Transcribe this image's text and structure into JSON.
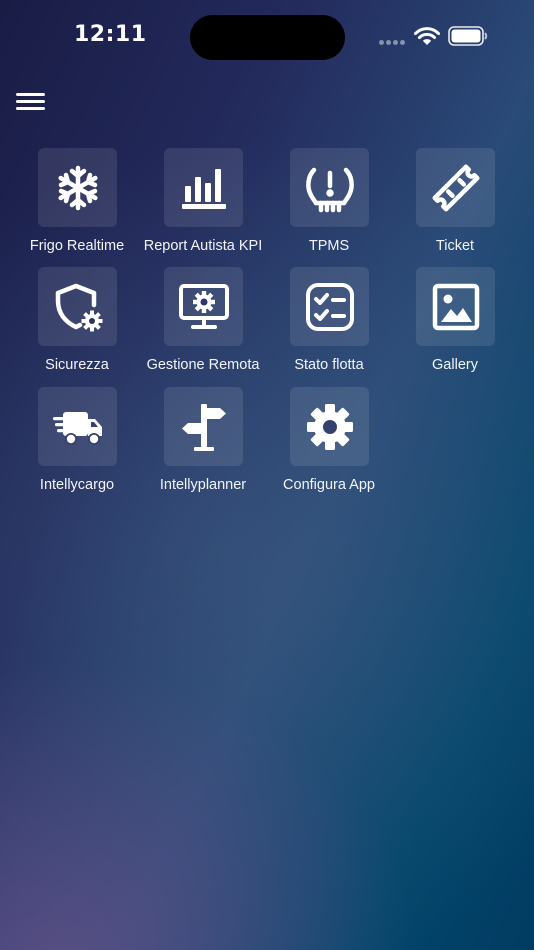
{
  "status_bar": {
    "time": "12:11"
  },
  "header": {
    "menu_icon": "hamburger-menu-icon"
  },
  "apps": [
    {
      "label": "Frigo Realtime",
      "icon": "snowflake-icon"
    },
    {
      "label": "Report Autista KPI",
      "icon": "bar-chart-icon"
    },
    {
      "label": "TPMS",
      "icon": "tire-pressure-warning-icon"
    },
    {
      "label": "Ticket",
      "icon": "ticket-icon"
    },
    {
      "label": "Sicurezza",
      "icon": "shield-gear-icon"
    },
    {
      "label": "Gestione Remota",
      "icon": "monitor-gear-icon"
    },
    {
      "label": "Stato flotta",
      "icon": "checklist-icon"
    },
    {
      "label": "Gallery",
      "icon": "image-icon"
    },
    {
      "label": "Intellycargo",
      "icon": "fast-truck-icon"
    },
    {
      "label": "Intellyplanner",
      "icon": "signpost-icon"
    },
    {
      "label": "Configura App",
      "icon": "gear-icon"
    }
  ],
  "colors": {
    "background_start": "#191c45",
    "background_end": "#013b62",
    "tile_background": "rgba(255,255,255,0.1)",
    "text": "#ffffff"
  }
}
